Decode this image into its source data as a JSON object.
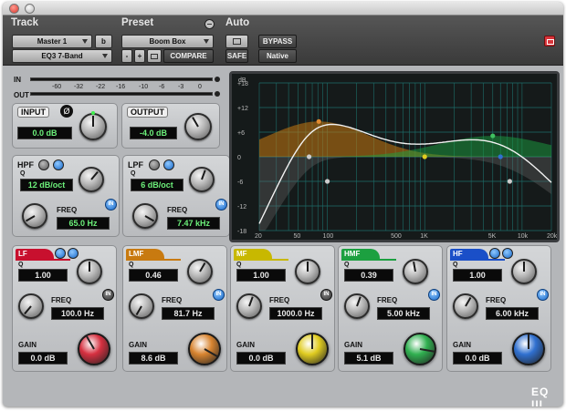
{
  "header": {
    "track_label": "Track",
    "preset_label": "Preset",
    "auto_label": "Auto",
    "track_name": "Master 1",
    "track_channel": "b",
    "plugin_name": "EQ3 7-Band",
    "preset_name": "Boom Box",
    "minus": "-",
    "plus": "+",
    "compare": "COMPARE",
    "bypass": "BYPASS",
    "safe": "SAFE",
    "native": "Native"
  },
  "meters": {
    "in_label": "IN",
    "out_label": "OUT",
    "ticks": [
      "-60",
      "-32",
      "-22",
      "-16",
      "-10",
      "-6",
      "-3",
      "0"
    ]
  },
  "input": {
    "label": "INPUT",
    "value": "0.0 dB",
    "phase": "Ø"
  },
  "output": {
    "label": "OUTPUT",
    "value": "-4.0 dB"
  },
  "hpf": {
    "label": "HPF",
    "q_label": "Q",
    "q_value": "12 dB/oct",
    "freq_label": "FREQ",
    "freq_value": "65.0 Hz",
    "in": "IN"
  },
  "lpf": {
    "label": "LPF",
    "q_label": "Q",
    "q_value": "6 dB/oct",
    "freq_label": "FREQ",
    "freq_value": "7.47 kHz",
    "in": "IN"
  },
  "bands": [
    {
      "name": "LF",
      "q_label": "Q",
      "q": "1.00",
      "freq_label": "FREQ",
      "freq": "100.0 Hz",
      "gain_label": "GAIN",
      "gain": "0.0 dB",
      "in": "IN",
      "color": "#c8102e",
      "knob": "#d63040",
      "in_active": false
    },
    {
      "name": "LMF",
      "q_label": "Q",
      "q": "0.46",
      "freq_label": "FREQ",
      "freq": "81.7 Hz",
      "gain_label": "GAIN",
      "gain": "8.6 dB",
      "in": "IN",
      "color": "#c87a10",
      "knob": "#d88430",
      "in_active": true
    },
    {
      "name": "MF",
      "q_label": "Q",
      "q": "1.00",
      "freq_label": "FREQ",
      "freq": "1000.0 Hz",
      "gain_label": "GAIN",
      "gain": "0.0 dB",
      "in": "IN",
      "color": "#c8b800",
      "knob": "#e0cc20",
      "in_active": false
    },
    {
      "name": "HMF",
      "q_label": "Q",
      "q": "0.39",
      "freq_label": "FREQ",
      "freq": "5.00 kHz",
      "gain_label": "GAIN",
      "gain": "5.1 dB",
      "in": "IN",
      "color": "#1ca040",
      "knob": "#30b050",
      "in_active": true
    },
    {
      "name": "HF",
      "q_label": "Q",
      "q": "1.00",
      "freq_label": "FREQ",
      "freq": "6.00 kHz",
      "gain_label": "GAIN",
      "gain": "0.0 dB",
      "in": "IN",
      "color": "#1a4fc8",
      "knob": "#3070d0",
      "in_active": true
    }
  ],
  "graph": {
    "db_unit": "dB",
    "db_ticks": [
      "+18",
      "+12",
      "+6",
      "0",
      "-6",
      "-12",
      "-18"
    ],
    "freq_ticks": [
      "20",
      "50",
      "100",
      "500",
      "1K",
      "5K",
      "10k",
      "20k"
    ]
  },
  "logo": "EQ III"
}
